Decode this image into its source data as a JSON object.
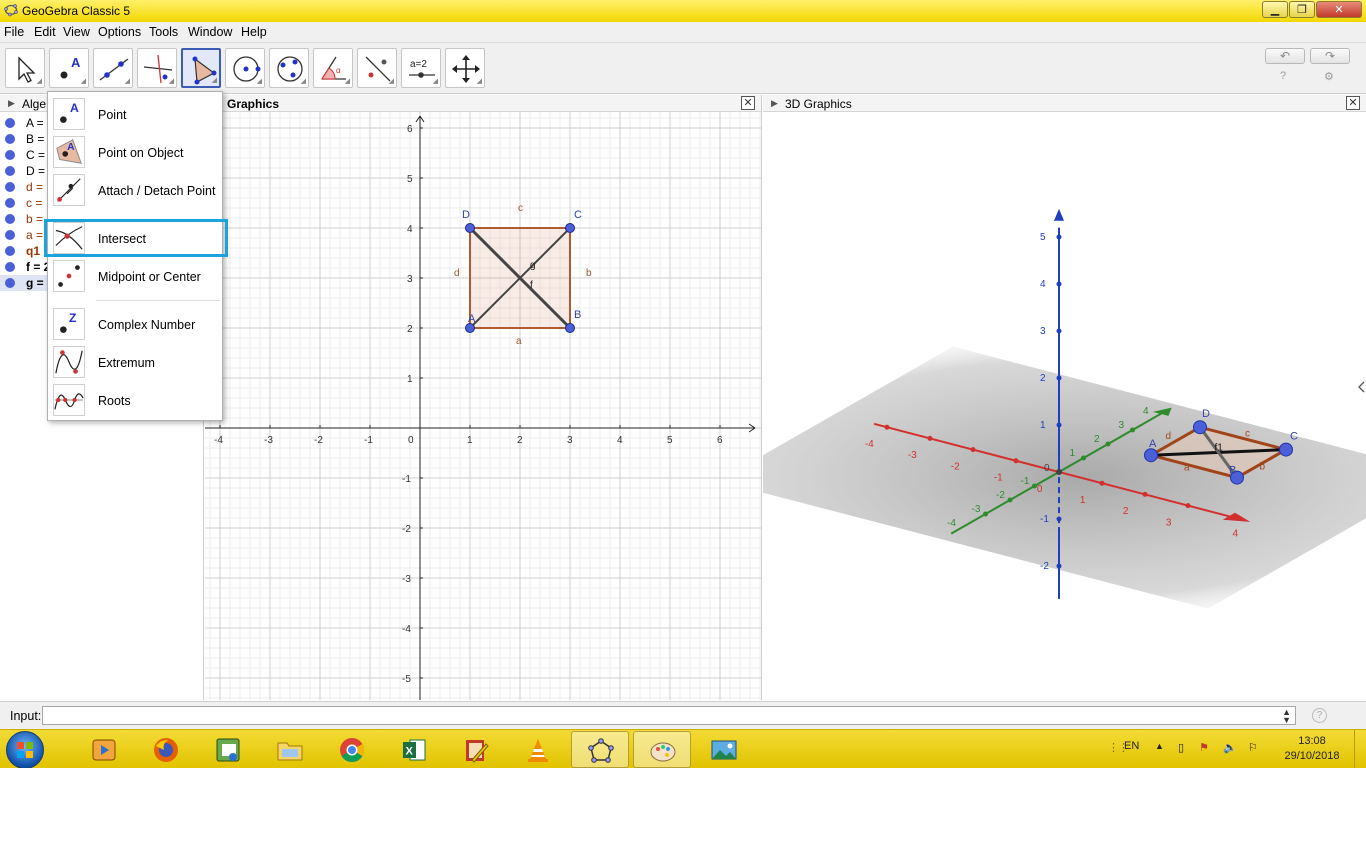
{
  "window": {
    "title": "GeoGebra Classic 5",
    "min_label": "▁",
    "max_label": "❐",
    "close_label": "✕"
  },
  "menubar": {
    "items": [
      "File",
      "Edit",
      "View",
      "Options",
      "Tools",
      "Window",
      "Help"
    ]
  },
  "toolbar": {
    "tools": [
      "move-tool",
      "point-tool",
      "line-tool",
      "perpendicular-line-tool",
      "polygon-tool",
      "circle-tool",
      "circle-through-three-points-tool",
      "angle-tool",
      "reflect-tool",
      "slider-tool",
      "move-graphics-view-tool"
    ],
    "slider_label": "a=2",
    "undo": "↶",
    "redo": "↷",
    "help": "?",
    "settings": "⚙"
  },
  "algebra": {
    "title": "Alge",
    "rows": [
      "A =",
      "B =",
      "C =",
      "D =",
      "d =",
      "c =",
      "b =",
      "a =",
      "q1",
      "f = 2",
      "g ="
    ]
  },
  "graphics": {
    "title": "Graphics",
    "x_ticks": [
      "-4",
      "-3",
      "-2",
      "-1",
      "0",
      "1",
      "2",
      "3",
      "4",
      "5",
      "6"
    ],
    "y_ticks": [
      "6",
      "5",
      "4",
      "3",
      "2",
      "1",
      "-1",
      "-2",
      "-3",
      "-4",
      "-5"
    ],
    "points": {
      "A": "A",
      "B": "B",
      "C": "C",
      "D": "D"
    },
    "segments": {
      "a": "a",
      "b": "b",
      "c": "c",
      "d": "d",
      "f": "f",
      "g": "g"
    }
  },
  "graphics3d": {
    "title": "3D Graphics",
    "z_ticks": [
      "5",
      "4",
      "3",
      "2",
      "1",
      "-1",
      "-2"
    ],
    "x_ticks": [
      "-4",
      "-3",
      "-2",
      "-1",
      "0",
      "1",
      "2",
      "3",
      "4"
    ],
    "y_ticks": [
      "4",
      "3",
      "2",
      "1",
      "-1",
      "-2",
      "-3",
      "-4"
    ],
    "origin_label": "0",
    "points": {
      "A": "A",
      "B": "B",
      "C": "C",
      "D": "D"
    },
    "segments": {
      "a": "a",
      "b": "b",
      "c": "c",
      "d": "d",
      "f": "f1"
    }
  },
  "popup_menu": {
    "items": [
      "Point",
      "Point on Object",
      "Attach / Detach Point",
      "Intersect",
      "Midpoint or Center",
      "Complex Number",
      "Extremum",
      "Roots"
    ],
    "highlighted": "Intersect"
  },
  "input_bar": {
    "label": "Input:",
    "value": "",
    "help": "?"
  },
  "taskbar": {
    "language": "EN",
    "time": "13:08",
    "date": "29/10/2018",
    "apps": [
      "media-player",
      "firefox",
      "geogebra-installer",
      "file-explorer",
      "chrome",
      "excel",
      "writer-app",
      "vlc",
      "geogebra",
      "paint",
      "photo-viewer"
    ]
  }
}
